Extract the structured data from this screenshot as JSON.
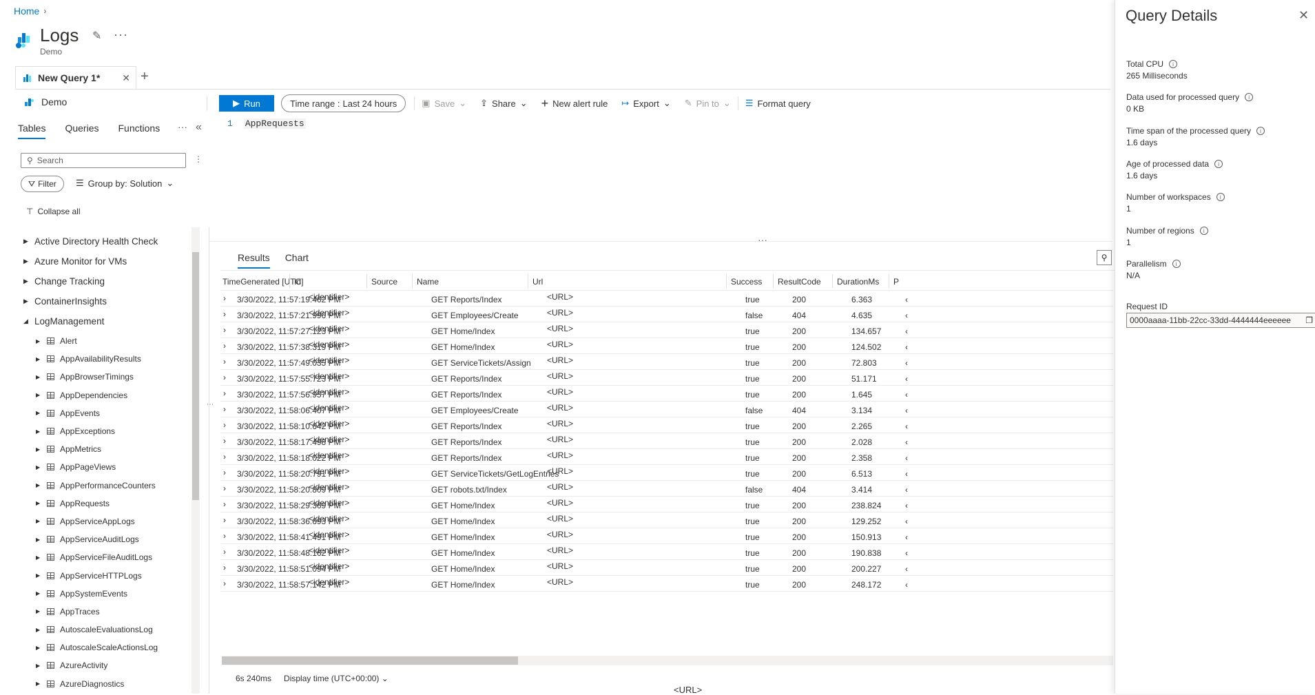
{
  "breadcrumb": {
    "home": "Home"
  },
  "header": {
    "title": "Logs",
    "subtitle": "Demo"
  },
  "query_tab": {
    "label": "New Query 1*"
  },
  "scope": {
    "label": "Demo"
  },
  "toolbar": {
    "run": "Run",
    "time_range_prefix": "Time range :",
    "time_range_value": "Last 24 hours",
    "save": "Save",
    "share": "Share",
    "new_alert": "New alert rule",
    "export": "Export",
    "pin_to": "Pin to",
    "format_query": "Format query"
  },
  "left_tabs": {
    "tables": "Tables",
    "queries": "Queries",
    "functions": "Functions"
  },
  "search": {
    "placeholder": "Search"
  },
  "filter": {
    "label": "Filter"
  },
  "group_by": {
    "label": "Group by: Solution"
  },
  "collapse_all": "Collapse all",
  "tree": {
    "solutions": [
      "Active Directory Health Check",
      "Azure Monitor for VMs",
      "Change Tracking",
      "ContainerInsights",
      "LogManagement"
    ],
    "tables": [
      "Alert",
      "AppAvailabilityResults",
      "AppBrowserTimings",
      "AppDependencies",
      "AppEvents",
      "AppExceptions",
      "AppMetrics",
      "AppPageViews",
      "AppPerformanceCounters",
      "AppRequests",
      "AppServiceAppLogs",
      "AppServiceAuditLogs",
      "AppServiceFileAuditLogs",
      "AppServiceHTTPLogs",
      "AppSystemEvents",
      "AppTraces",
      "AutoscaleEvaluationsLog",
      "AutoscaleScaleActionsLog",
      "AzureActivity",
      "AzureDiagnostics"
    ]
  },
  "editor": {
    "line": "1",
    "code": "AppRequests"
  },
  "results_tabs": {
    "results": "Results",
    "chart": "Chart"
  },
  "grid": {
    "columns": [
      "TimeGenerated [UTC]",
      "Id",
      "Source",
      "Name",
      "Url",
      "Success",
      "ResultCode",
      "DurationMs",
      "P"
    ],
    "rows": [
      [
        "3/30/2022, 11:57:19.462 PM",
        "<identifier>",
        "",
        "GET Reports/Index",
        "<URL>",
        "true",
        "200",
        "6.363"
      ],
      [
        "3/30/2022, 11:57:21.996 PM",
        "<identifier>",
        "",
        "GET Employees/Create",
        "<URL>",
        "false",
        "404",
        "4.635"
      ],
      [
        "3/30/2022, 11:57:27.123 PM",
        "<identifier>",
        "",
        "GET Home/Index",
        "<URL>",
        "true",
        "200",
        "134.657"
      ],
      [
        "3/30/2022, 11:57:38.319 PM",
        "<identifier>",
        "",
        "GET Home/Index",
        "<URL>",
        "true",
        "200",
        "124.502"
      ],
      [
        "3/30/2022, 11:57:49.035 PM",
        "<identifier>",
        "",
        "GET ServiceTickets/Assign",
        "<URL>",
        "true",
        "200",
        "72.803"
      ],
      [
        "3/30/2022, 11:57:55.723 PM",
        "<identifier>",
        "",
        "GET Reports/Index",
        "<URL>",
        "true",
        "200",
        "51.171"
      ],
      [
        "3/30/2022, 11:57:56.957 PM",
        "<identifier>",
        "",
        "GET Reports/Index",
        "<URL>",
        "true",
        "200",
        "1.645"
      ],
      [
        "3/30/2022, 11:58:06.407 PM",
        "<identifier>",
        "",
        "GET Employees/Create",
        "<URL>",
        "false",
        "404",
        "3.134"
      ],
      [
        "3/30/2022, 11:58:10.642 PM",
        "<identifier>",
        "",
        "GET Reports/Index",
        "<URL>",
        "true",
        "200",
        "2.265"
      ],
      [
        "3/30/2022, 11:58:17.498 PM",
        "<identifier>",
        "",
        "GET Reports/Index",
        "<URL>",
        "true",
        "200",
        "2.028"
      ],
      [
        "3/30/2022, 11:58:18.022 PM",
        "<identifier>",
        "",
        "GET Reports/Index",
        "<URL>",
        "true",
        "200",
        "2.358"
      ],
      [
        "3/30/2022, 11:58:20.791 PM",
        "<identifier>",
        "",
        "GET ServiceTickets/GetLogEntries",
        "<URL>",
        "true",
        "200",
        "6.513"
      ],
      [
        "3/30/2022, 11:58:20.809 PM",
        "<identifier>",
        "",
        "GET robots.txt/Index",
        "<URL>",
        "false",
        "404",
        "3.414"
      ],
      [
        "3/30/2022, 11:58:29.369 PM",
        "<identifier>",
        "",
        "GET Home/Index",
        "<URL>",
        "true",
        "200",
        "238.824"
      ],
      [
        "3/30/2022, 11:58:36.693 PM",
        "<identifier>",
        "",
        "GET Home/Index",
        "<URL>",
        "true",
        "200",
        "129.252"
      ],
      [
        "3/30/2022, 11:58:41.491 PM",
        "<identifier>",
        "",
        "GET Home/Index",
        "<URL>",
        "true",
        "200",
        "150.913"
      ],
      [
        "3/30/2022, 11:58:48.162 PM",
        "<identifier>",
        "",
        "GET Home/Index",
        "<URL>",
        "true",
        "200",
        "190.838"
      ],
      [
        "3/30/2022, 11:58:51.094 PM",
        "<identifier>",
        "",
        "GET Home/Index",
        "<URL>",
        "true",
        "200",
        "200.227"
      ],
      [
        "3/30/2022, 11:58:57.142 PM",
        "<identifier>",
        "",
        "GET Home/Index",
        "<URL>",
        "true",
        "200",
        "248.172"
      ]
    ]
  },
  "footer": {
    "duration": "6s 240ms",
    "display_time": "Display time (UTC+00:00)",
    "url": "<URL>"
  },
  "panel": {
    "title": "Query Details",
    "fields": [
      {
        "label": "Total CPU",
        "value": "265 Milliseconds"
      },
      {
        "label": "Data used for processed query",
        "value": "0 KB"
      },
      {
        "label": "Time span of the processed query",
        "value": "1.6 days"
      },
      {
        "label": "Age of processed data",
        "value": "1.6 days"
      },
      {
        "label": "Number of workspaces",
        "value": "1"
      },
      {
        "label": "Number of regions",
        "value": "1"
      },
      {
        "label": "Parallelism",
        "value": "N/A"
      }
    ],
    "request_id_label": "Request ID",
    "request_id": "0000aaaa-11bb-22cc-33dd-4444444eeeeee"
  },
  "colors": {
    "accent": "#0078d4"
  }
}
